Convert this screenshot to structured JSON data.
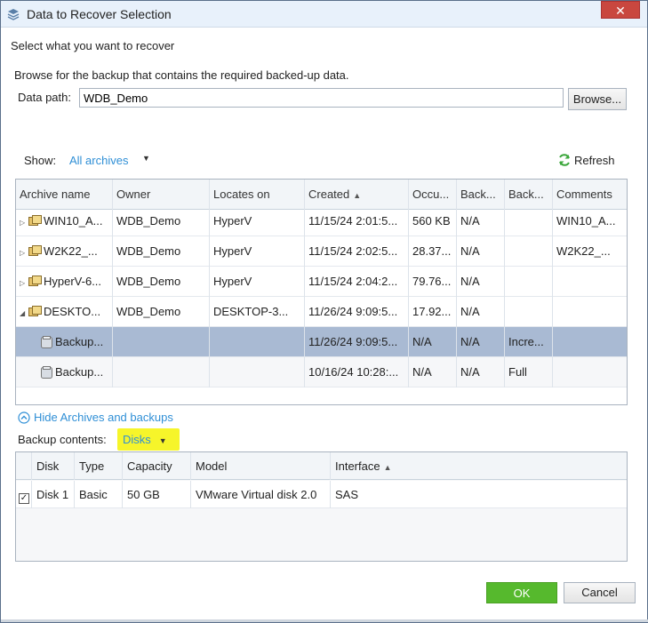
{
  "window": {
    "title": "Data to Recover Selection",
    "close_label": "✕"
  },
  "page": {
    "heading": "Select what you want to recover",
    "browse_instruction": "Browse for the backup that contains the required backed-up data.",
    "data_path_label": "Data path:",
    "data_path_value": "WDB_Demo",
    "browse_button": "Browse..."
  },
  "archives": {
    "show_label": "Show:",
    "show_value": "All archives",
    "refresh_label": "Refresh",
    "columns": [
      "Archive name",
      "Owner",
      "Locates on",
      "Created",
      "Occu...",
      "Back...",
      "Back...",
      "Comments"
    ],
    "rows": [
      [
        "WIN10_A...",
        "WDB_Demo",
        "HyperV",
        "11/15/24 2:01:5...",
        "560 KB",
        "N/A",
        "",
        "WIN10_A..."
      ],
      [
        "W2K22_...",
        "WDB_Demo",
        "HyperV",
        "11/15/24 2:02:5...",
        "28.37...",
        "N/A",
        "",
        "W2K22_..."
      ],
      [
        "HyperV-6...",
        "WDB_Demo",
        "HyperV",
        "11/15/24 2:04:2...",
        "79.76...",
        "N/A",
        "",
        ""
      ],
      [
        "DESKTO...",
        "WDB_Demo",
        "DESKTOP-3...",
        "11/26/24 9:09:5...",
        "17.92...",
        "N/A",
        "",
        ""
      ],
      [
        "Backup...",
        "",
        "",
        "11/26/24 9:09:5...",
        "N/A",
        "N/A",
        "Incre...",
        ""
      ],
      [
        "Backup...",
        "",
        "",
        "10/16/24 10:28:...",
        "N/A",
        "N/A",
        "Full",
        ""
      ]
    ],
    "expanders": [
      "▷",
      "▷",
      "▷",
      "◢"
    ]
  },
  "contents": {
    "hide_link": "Hide Archives and backups",
    "label": "Backup contents:",
    "dropdown_value": "Disks",
    "columns": [
      "Disk",
      "Type",
      "Capacity",
      "Model",
      "Interface"
    ],
    "rows": [
      [
        "Disk 1",
        "Basic",
        "50 GB",
        "VMware Virtual disk 2.0",
        "SAS"
      ]
    ],
    "checkmark": "✓"
  },
  "footer": {
    "ok_label": "OK",
    "cancel_label": "Cancel"
  },
  "colors": {
    "accent_link": "#2f8fd6",
    "selected_row": "#a9bad3",
    "ok_button": "#56b92d",
    "highlight": "#f6f52a",
    "close_button": "#c9473f"
  }
}
